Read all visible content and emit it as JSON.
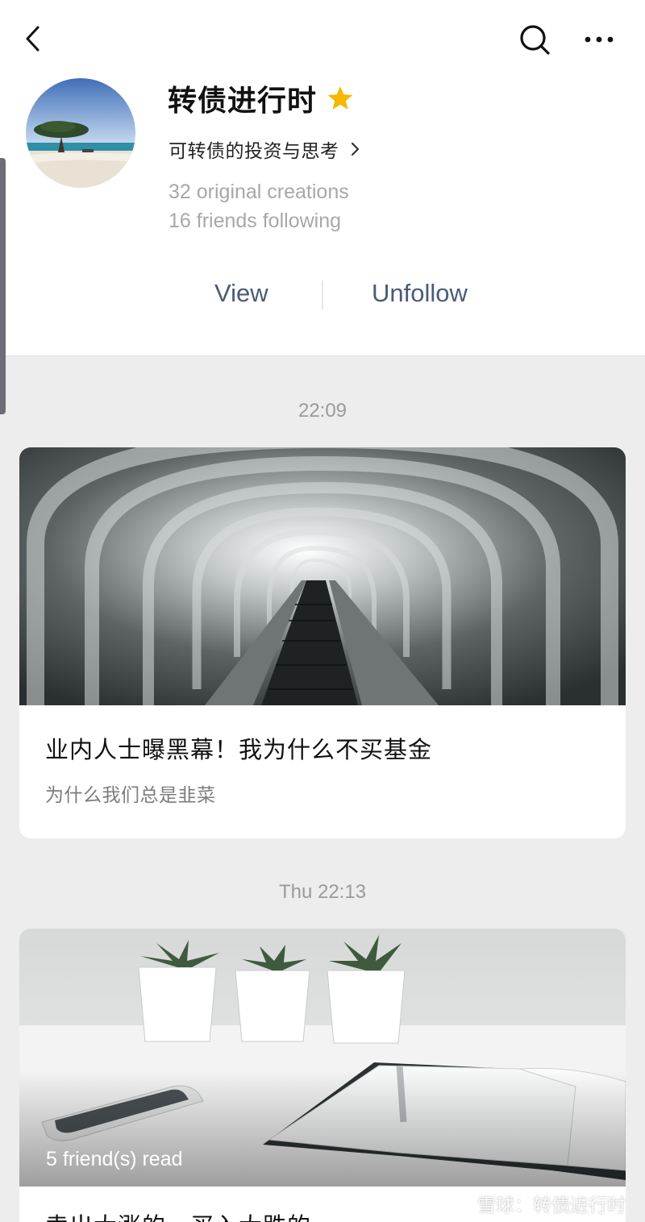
{
  "profile": {
    "name": "转债进行时",
    "description": "可转债的投资与思考",
    "original_creations": "32 original creations",
    "friends_following": "16 friends following",
    "starred": true,
    "star_color": "#f5b800"
  },
  "actions": {
    "view": "View",
    "unfollow": "Unfollow",
    "link_color": "#4a5b78"
  },
  "feed": [
    {
      "time": "22:09",
      "title": "业内人士曝黑幕！我为什么不买基金",
      "subtitle": "为什么我们总是韭菜"
    },
    {
      "time": "Thu 22:13",
      "friends_read": "5 friend(s) read",
      "title": "卖出大涨的，买入大跌的"
    }
  ],
  "watermark": {
    "text": "雪球：转债进行时"
  }
}
